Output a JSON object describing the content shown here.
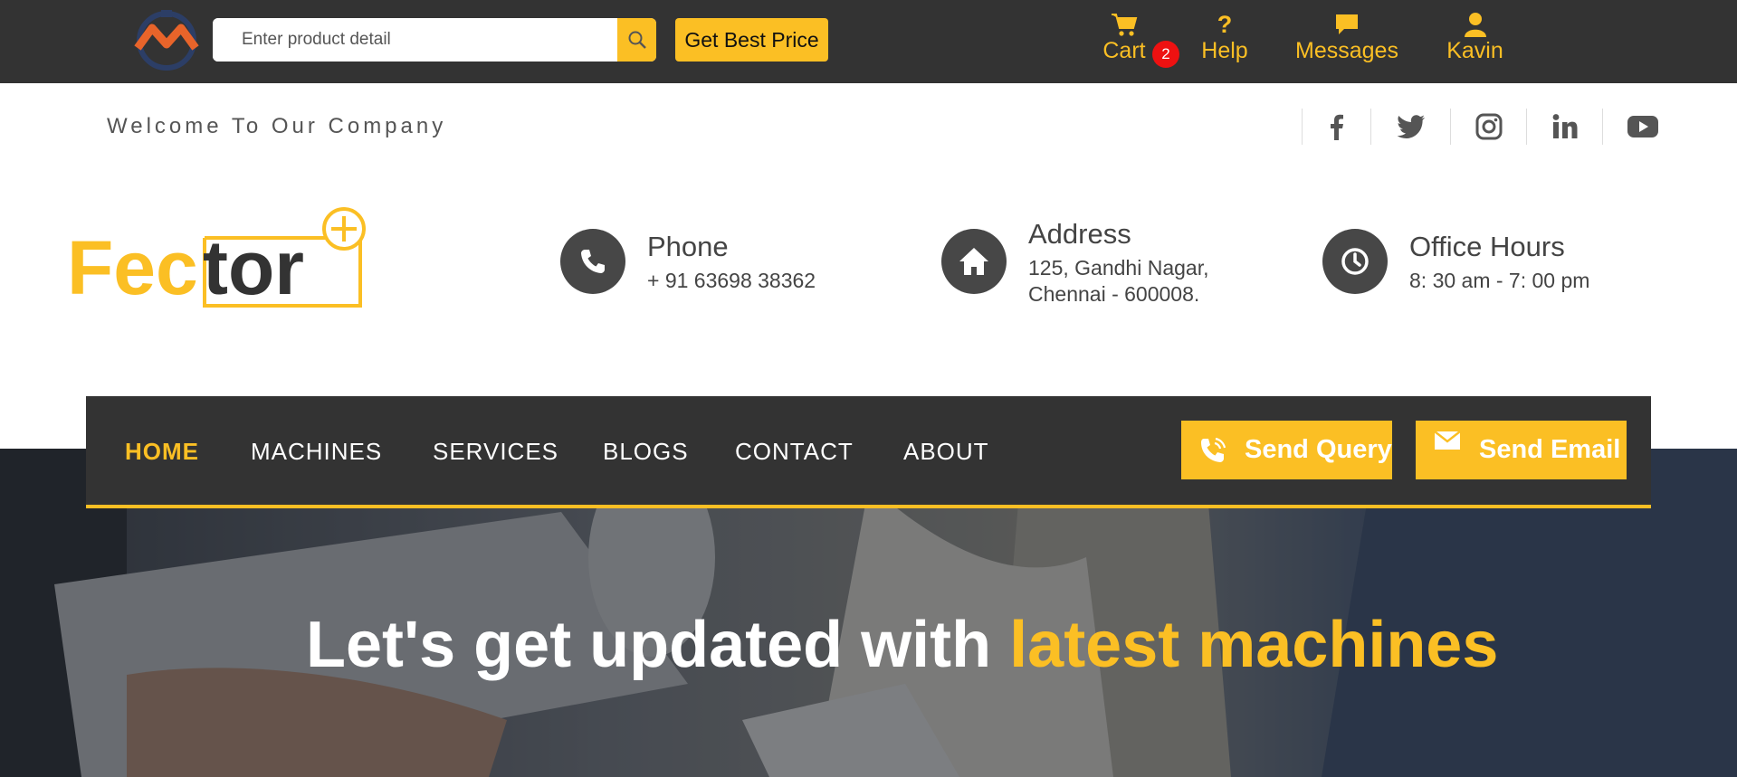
{
  "header": {
    "search_placeholder": "Enter product detail",
    "best_price_label": "Get Best Price",
    "cart_label": "Cart",
    "cart_count": "2",
    "help_label": "Help",
    "messages_label": "Messages",
    "user_label": "Kavin"
  },
  "topstrip": {
    "welcome": "Welcome To Our Company",
    "social": [
      "facebook-icon",
      "twitter-icon",
      "instagram-icon",
      "linkedin-icon",
      "youtube-icon"
    ]
  },
  "brand": {
    "fec": "Fec",
    "tor": "tor"
  },
  "contact": {
    "phone_title": "Phone",
    "phone_value": "+ 91 63698 38362",
    "address_title": "Address",
    "address_line1": "125, Gandhi Nagar,",
    "address_line2": "Chennai - 600008.",
    "hours_title": "Office Hours",
    "hours_value": "8: 30 am - 7: 00 pm"
  },
  "nav": {
    "home": "HOME",
    "machines": "MACHINES",
    "services": "SERVICES",
    "blogs": "BLOGS",
    "contact": "CONTACT",
    "about": "ABOUT",
    "send_query": "Send Query",
    "send_email": "Send Email"
  },
  "hero": {
    "headline_part1": "Let's get updated with ",
    "headline_part2": "latest machines"
  },
  "colors": {
    "accent": "#fbbf24",
    "dark": "#333333",
    "badge": "#e11111"
  }
}
